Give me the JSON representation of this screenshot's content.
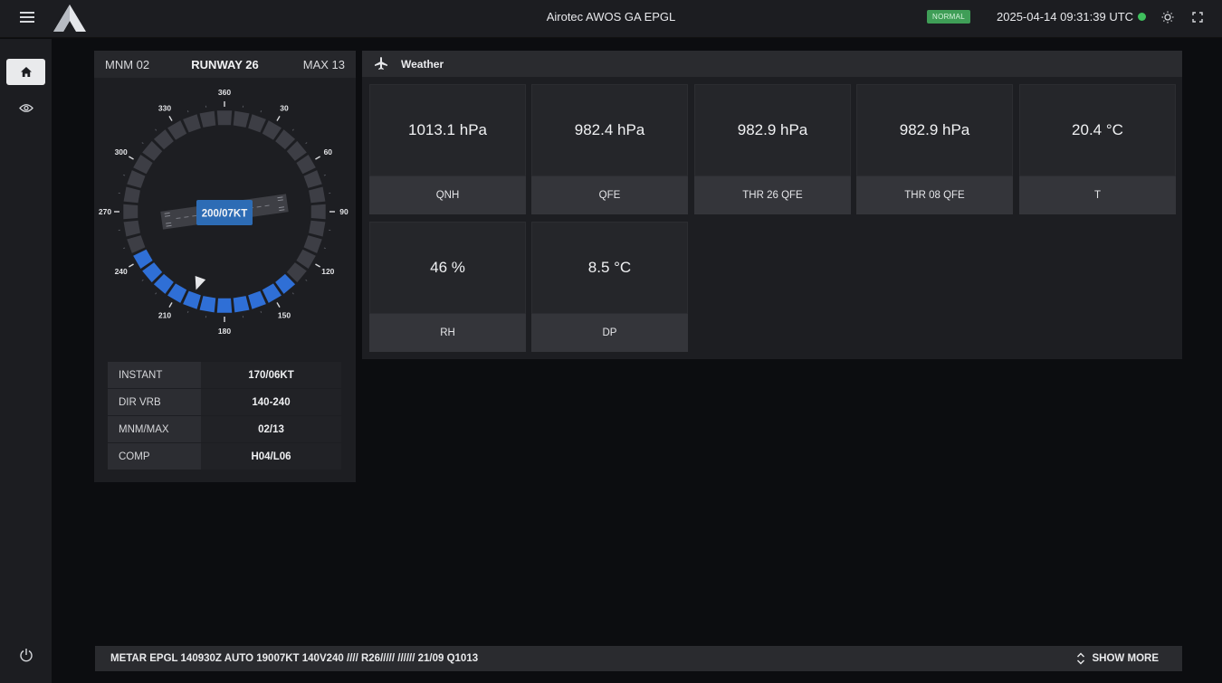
{
  "header": {
    "title": "Airotec AWOS GA EPGL",
    "status": "NORMAL",
    "datetime": "2025-04-14 09:31:39 UTC",
    "status_color": "#3f9e57",
    "online_color": "#3fbf5d"
  },
  "sidebar": {
    "items": [
      {
        "name": "home",
        "icon": "home-icon",
        "active": true
      },
      {
        "name": "view",
        "icon": "eye-icon",
        "active": false
      }
    ],
    "footer_icon": "power-icon"
  },
  "wind": {
    "minimum": "MNM 02",
    "runway": "RUNWAY 26",
    "maximum": "MAX 13",
    "current_wind": "200/07KT",
    "direction_pointer_deg": 200,
    "variable_range_deg": [
      140,
      240
    ],
    "rose_labels": [
      "360",
      "30",
      "60",
      "90",
      "120",
      "150",
      "180",
      "210",
      "240",
      "270",
      "300",
      "330"
    ],
    "table": [
      {
        "key": "INSTANT",
        "value": "170/06KT"
      },
      {
        "key": "DIR VRB",
        "value": "140-240"
      },
      {
        "key": "MNM/MAX",
        "value": "02/13"
      },
      {
        "key": "COMP",
        "value": "H04/L06"
      }
    ],
    "colors": {
      "variable_segment": "#2f6fd6",
      "segment": "#3d3e45",
      "runway_label": "#2d6cb5"
    }
  },
  "weather": {
    "title": "Weather",
    "tiles": [
      {
        "value": "1013.1 hPa",
        "label": "QNH"
      },
      {
        "value": "982.4 hPa",
        "label": "QFE"
      },
      {
        "value": "982.9 hPa",
        "label": "THR 26 QFE"
      },
      {
        "value": "982.9 hPa",
        "label": "THR 08 QFE"
      },
      {
        "value": "20.4 °C",
        "label": "T"
      },
      {
        "value": "46 %",
        "label": "RH"
      },
      {
        "value": "8.5 °C",
        "label": "DP"
      }
    ]
  },
  "metar": {
    "text": "METAR EPGL 140930Z AUTO 19007KT 140V240 //// R26///// ////// 21/09 Q1013",
    "show_more_label": "SHOW MORE"
  }
}
